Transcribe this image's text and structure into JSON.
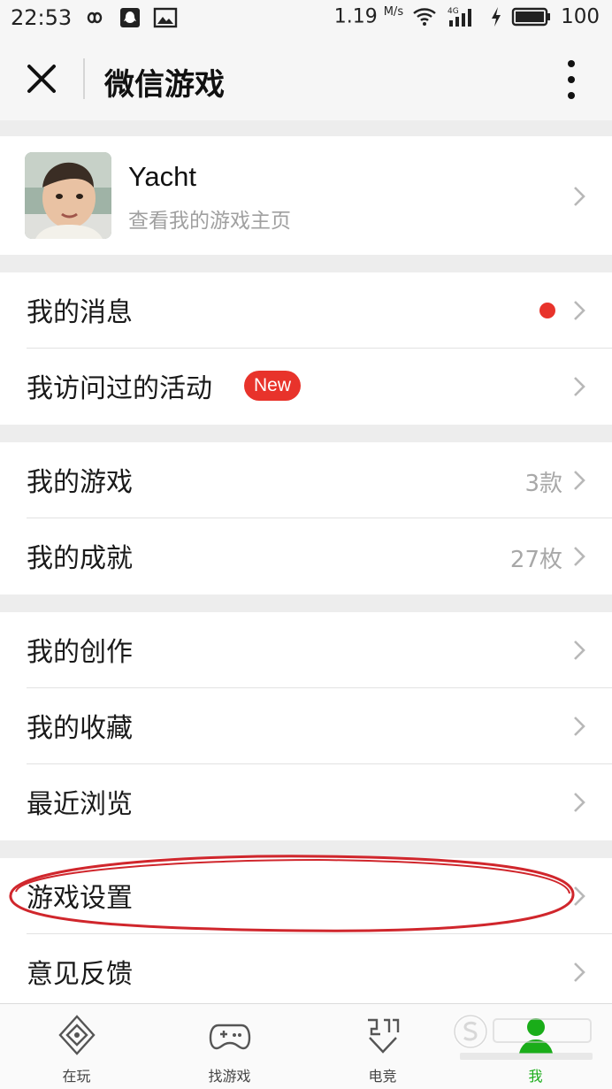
{
  "status_bar": {
    "time": "22:53",
    "speed": "1.19",
    "speed_unit": "M/s",
    "network": "4G",
    "battery": "100"
  },
  "header": {
    "title": "微信游戏",
    "close_icon": "close-icon",
    "more_icon": "more-vertical-icon"
  },
  "profile": {
    "name": "Yacht",
    "subtitle": "查看我的游戏主页"
  },
  "sections": [
    [
      {
        "label": "我的消息",
        "dot": true
      },
      {
        "label": "我访问过的活动",
        "badge": "New"
      }
    ],
    [
      {
        "label": "我的游戏",
        "value": "3款"
      },
      {
        "label": "我的成就",
        "value": "27枚"
      }
    ],
    [
      {
        "label": "我的创作"
      },
      {
        "label": "我的收藏"
      },
      {
        "label": "最近浏览"
      }
    ],
    [
      {
        "label": "游戏设置"
      },
      {
        "label": "意见反馈"
      }
    ]
  ],
  "tabs": [
    {
      "label": "在玩",
      "icon": "playing-icon"
    },
    {
      "label": "找游戏",
      "icon": "gamepad-icon"
    },
    {
      "label": "电竞",
      "icon": "esports-icon"
    },
    {
      "label": "我",
      "icon": "person-icon",
      "active": true
    }
  ],
  "colors": {
    "accent": "#1aad19",
    "badge": "#e8332b",
    "annotation": "#d0262c"
  }
}
